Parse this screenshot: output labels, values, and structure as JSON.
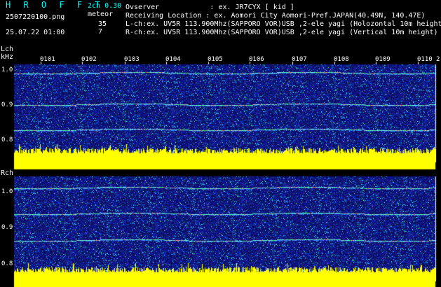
{
  "header": {
    "brand": "H R O F F T",
    "version": "2ch 0.30",
    "filename": "2507220100.png",
    "meteor_label": "meteor",
    "lch_count": "35",
    "rch_count": "7",
    "datetime": "25.07.22 01:00",
    "observer": "Ovserver            : ex. JR7CYX [ kid ]",
    "location": "Receiving Location : ex. Aomori City Aomori-Pref.JAPAN(40.49N, 140.47E)",
    "lch_info": "L-ch:ex. UV5R 113.900Mhz(SAPPORO VOR)USB ,2-ele yagi (Holozontal 10m height)",
    "rch_info": "R-ch:ex. UV5R 113.900Mhz(SAPPORO VOR)USB ,2-ele yagi (Vertical 10m height)"
  },
  "lch": {
    "label": "Lch",
    "unit": "kHz",
    "yticks": [
      "1.0",
      "0.9",
      "0.8"
    ],
    "time_ticks": [
      "0101",
      "0102",
      "0103",
      "0104",
      "0105",
      "0106",
      "0107",
      "0108",
      "0109",
      "0110"
    ],
    "edge_label": "2"
  },
  "rch": {
    "label": "Rch",
    "yticks": [
      "1.0",
      "0.9",
      "0.8"
    ]
  },
  "colors": {
    "background": "#000000",
    "noise_base": "#1a1a8a",
    "noise_bright": "#00c8ff",
    "amplitude": "#ffff00",
    "text": "#ffffff",
    "brand": "#00ffff",
    "count": "#00ff66"
  }
}
